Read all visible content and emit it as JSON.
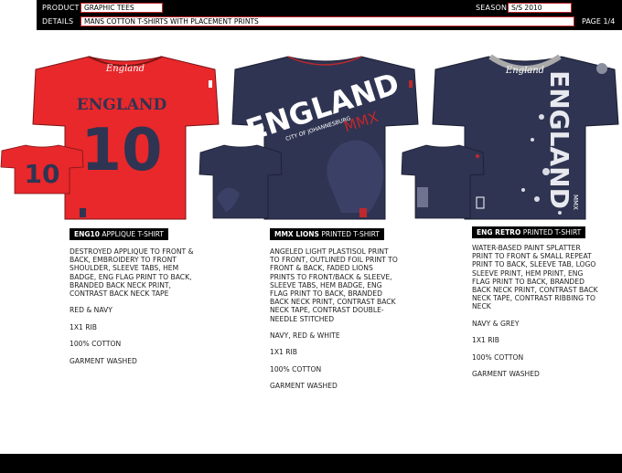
{
  "header": {
    "product_label": "PRODUCT",
    "product_value": "GRAPHIC TEES",
    "details_label": "DETAILS",
    "details_value": "MANS COTTON T-SHIRTS WITH PLACEMENT PRINTS",
    "season_label": "SEASON",
    "season_value": "S/S 2010",
    "page": "PAGE 1/4"
  },
  "colors": {
    "red_shirt": "#e8282b",
    "navy_shirt": "#2f3452",
    "accent_border": "#c0282d"
  },
  "products": [
    {
      "code": "ENG10",
      "name": "APPLIQUE T-SHIRT",
      "artwork": {
        "script_logo": "England",
        "word": "ENGLAND",
        "number": "10"
      },
      "description": "DESTROYED APPLIQUE TO FRONT & BACK, EMBROIDERY TO FRONT SHOULDER, SLEEVE TABS, HEM BADGE, ENG FLAG PRINT TO BACK, BRANDED BACK NECK PRINT, CONTRAST BACK NECK TAPE",
      "colors": "RED & NAVY",
      "rib": "1X1 RIB",
      "fabric": "100% COTTON",
      "finish": "GARMENT WASHED"
    },
    {
      "code": "MMX LIONS",
      "name": "PRINTED T-SHIRT",
      "artwork": {
        "word": "ENGLAND",
        "sub": "CITY OF JOHANNESBURG",
        "year": "MMX"
      },
      "description": "ANGELED LIGHT PLASTISOL PRINT TO FRONT, OUTLINED FOIL PRINT TO FRONT & BACK, FADED LIONS PRINTS TO FRONT/BACK & SLEEVE, SLEEVE TABS, HEM BADGE, ENG FLAG PRINT TO BACK, BRANDED BACK NECK PRINT, CONTRAST BACK NECK TAPE, CONTRAST DOUBLE-NEEDLE STITCHED",
      "colors": "NAVY, RED & WHITE",
      "rib": "1X1 RIB",
      "fabric": "100% COTTON",
      "finish": "GARMENT WASHED"
    },
    {
      "code": "ENG RETRO",
      "name": "PRINTED T-SHIRT",
      "artwork": {
        "script_logo": "England",
        "word": "ENGLAND",
        "year": "MMX"
      },
      "description": "WATER-BASED PAINT SPLATTER PRINT TO FRONT & SMALL REPEAT PRINT TO BACK, SLEEVE TAB, LOGO SLEEVE PRINT, HEM PRINT, ENG FLAG PRINT TO BACK, BRANDED BACK NECK PRINT, CONTRAST BACK NECK TAPE, CONTRAST RIBBING TO NECK",
      "colors": "NAVY & GREY",
      "rib": "1X1 RIB",
      "fabric": "100% COTTON",
      "finish": "GARMENT WASHED"
    }
  ]
}
